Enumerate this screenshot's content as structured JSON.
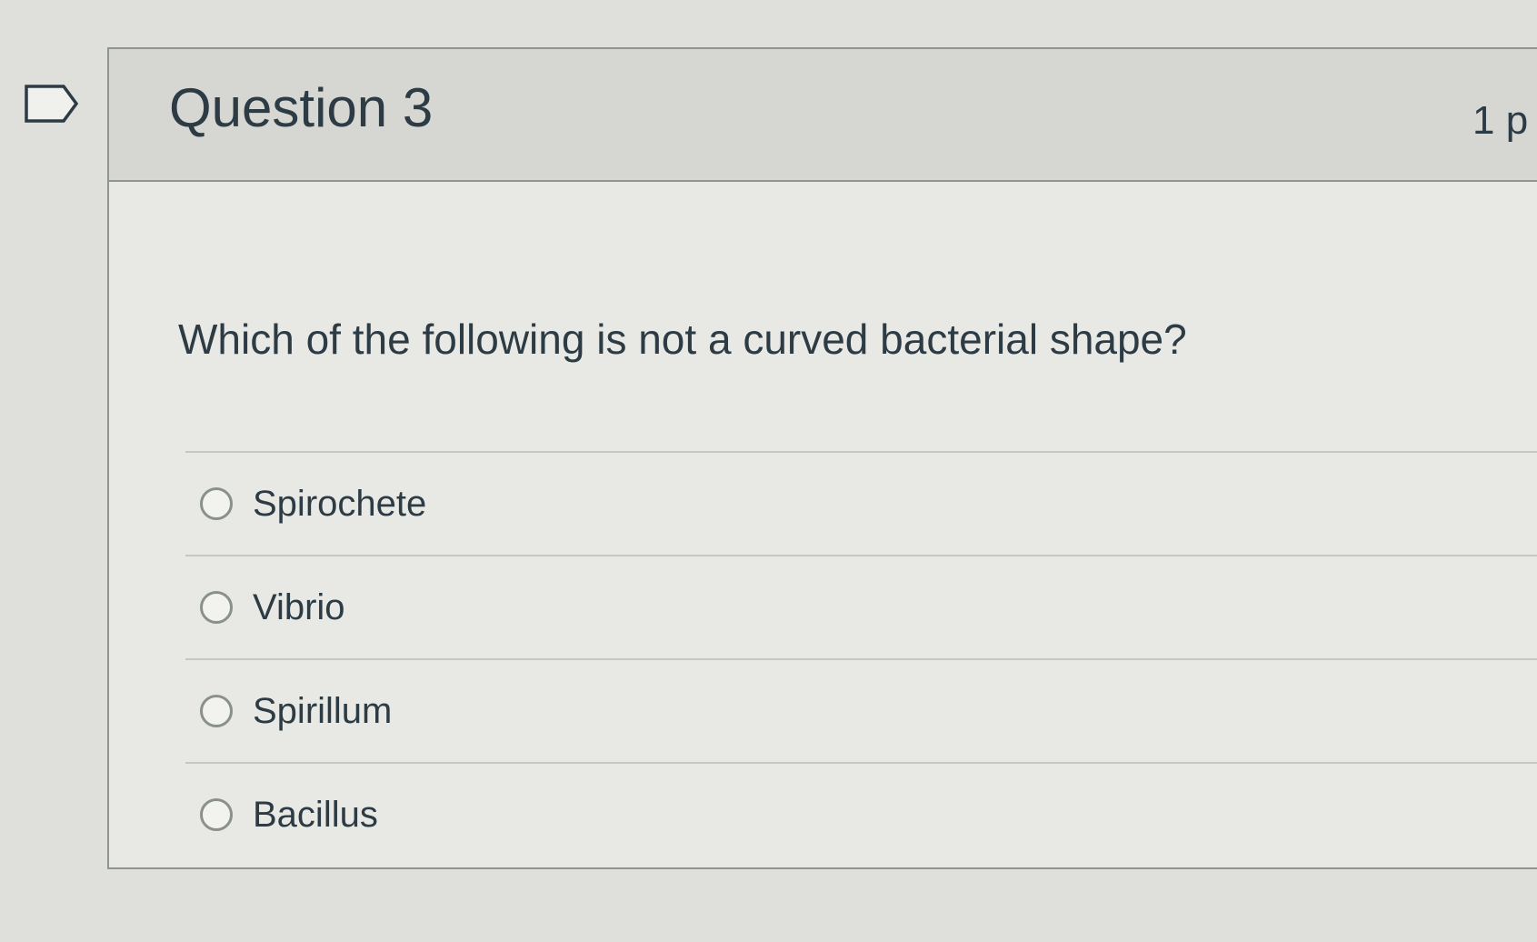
{
  "question": {
    "title": "Question 3",
    "points": "1 p",
    "text": "Which of the following is not a curved bacterial shape?",
    "answers": [
      {
        "label": "Spirochete"
      },
      {
        "label": "Vibrio"
      },
      {
        "label": "Spirillum"
      },
      {
        "label": "Bacillus"
      }
    ]
  },
  "colors": {
    "text": "#2d3b45",
    "background": "#dfe0dc",
    "border": "#8f9590"
  },
  "icons": {
    "flag": "flag-outline-icon"
  }
}
